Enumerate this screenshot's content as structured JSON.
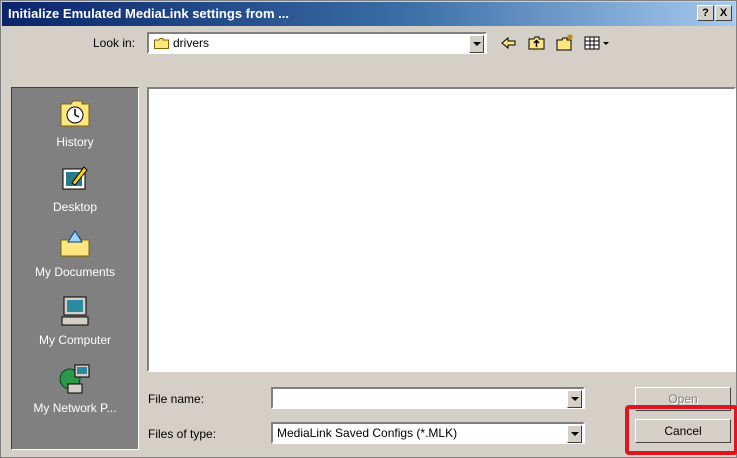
{
  "title": "Initialize Emulated MediaLink settings from ...",
  "titlebar_buttons": {
    "help": "?",
    "close": "X"
  },
  "look_in": {
    "label": "Look in:",
    "value": "drivers"
  },
  "toolbar": {
    "back_icon": "back-arrow-icon",
    "up_icon": "up-folder-icon",
    "new_folder_icon": "new-folder-icon",
    "view_icon": "view-menu-icon"
  },
  "places": [
    {
      "label": "History",
      "icon": "history-icon"
    },
    {
      "label": "Desktop",
      "icon": "desktop-icon"
    },
    {
      "label": "My Documents",
      "icon": "my-documents-icon"
    },
    {
      "label": "My Computer",
      "icon": "my-computer-icon"
    },
    {
      "label": "My Network P...",
      "icon": "my-network-icon"
    }
  ],
  "file_name": {
    "label": "File name:",
    "value": ""
  },
  "files_of_type": {
    "label": "Files of type:",
    "value": "MediaLink Saved Configs (*.MLK)"
  },
  "buttons": {
    "open": "Open",
    "cancel": "Cancel"
  },
  "colors": {
    "title_start": "#0a246a",
    "title_end": "#a6caf0",
    "highlight": "#e0141e",
    "face": "#d4d0c8"
  }
}
